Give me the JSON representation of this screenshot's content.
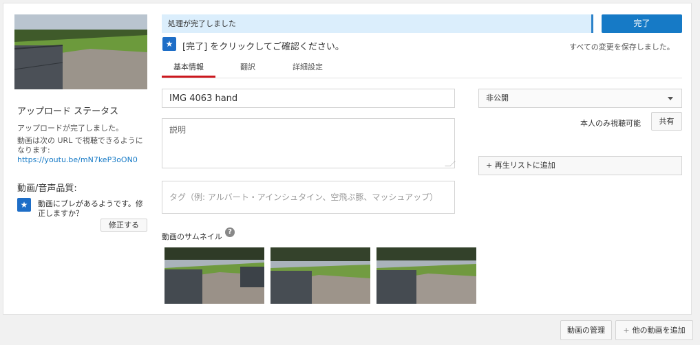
{
  "status": {
    "processing_message": "処理が完了しました",
    "done_label": "完了",
    "confirm_message": "[完了] をクリックしてご確認ください。",
    "saved_message": "すべての変更を保存しました。"
  },
  "left": {
    "upload_status_title": "アップロード ステータス",
    "upload_complete": "アップロードが完了しました。",
    "url_description": "動画は次の URL で視聴できるようになります:",
    "url": "https://youtu.be/mN7keP3oON0",
    "quality_title": "動画/音声品質:",
    "quality_message": "動画にブレがあるようです。修正しますか？",
    "fix_label": "修正する"
  },
  "tabs": [
    {
      "label": "基本情報",
      "active": true
    },
    {
      "label": "翻訳",
      "active": false
    },
    {
      "label": "詳細設定",
      "active": false
    }
  ],
  "form": {
    "title_value": "IMG 4063 hand",
    "description_placeholder": "説明",
    "tags_placeholder": "タグ（例: アルバート・アインシュタイン、空飛ぶ豚、マッシュアップ）",
    "privacy_value": "非公開",
    "visibility_note": "本人のみ視聴可能",
    "share_label": "共有",
    "playlist_label": "+ 再生リストに追加",
    "thumbnail_label": "動画のサムネイル",
    "help_glyph": "?"
  },
  "bottom": {
    "manage_label": "動画の管理",
    "add_more_label": "他の動画を追加",
    "plus_glyph": "+"
  },
  "icons": {
    "star_badge": "star-icon",
    "help": "help-icon",
    "caret": "chevron-down-icon"
  },
  "colors": {
    "accent_blue": "#167ac6",
    "info_bar": "#dbeefc",
    "tab_underline": "#cc181e"
  }
}
